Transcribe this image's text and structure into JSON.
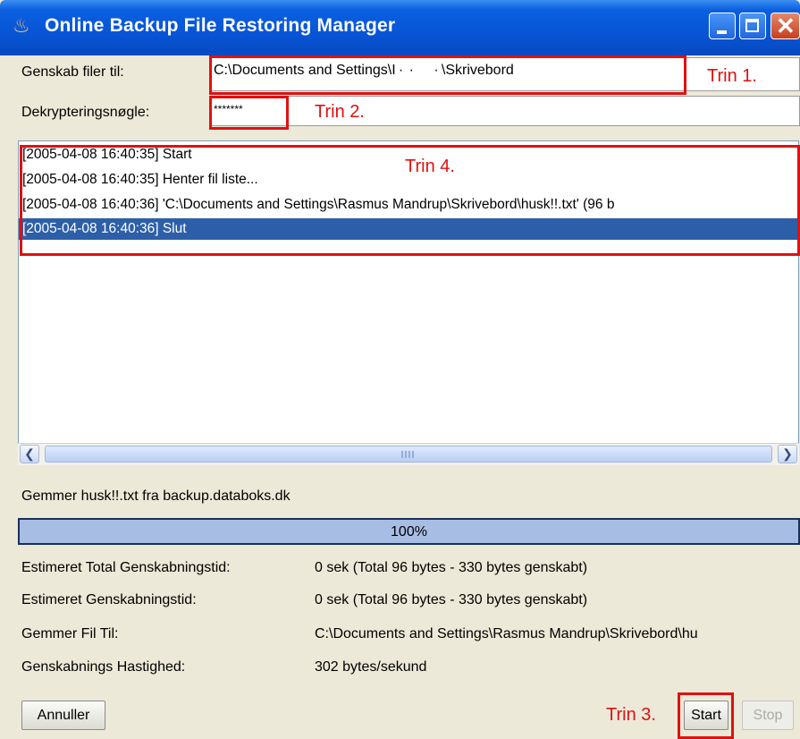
{
  "window": {
    "title": "Online Backup File Restoring Manager",
    "icon": "java-cup-icon"
  },
  "form": {
    "restore_to_label": "Genskab filer til:",
    "restore_to_value": "C:\\Documents and Settings\\I ·  ·       · \\Skrivebord",
    "key_label": "Dekrypteringsnøgle:",
    "key_value": "*******"
  },
  "annotations": {
    "trin1": "Trin 1.",
    "trin2": "Trin 2.",
    "trin3": "Trin 3.",
    "trin4": "Trin 4."
  },
  "log": {
    "lines": [
      "[2005-04-08 16:40:35] Start",
      "[2005-04-08 16:40:35] Henter fil liste...",
      "[2005-04-08 16:40:36] 'C:\\Documents and Settings\\Rasmus Mandrup\\Skrivebord\\husk!!.txt' (96 b",
      "[2005-04-08 16:40:36] Slut"
    ],
    "selected_index": 3
  },
  "status": {
    "message": "Gemmer husk!!.txt fra backup.databoks.dk",
    "progress_percent": 100,
    "progress_label": "100%"
  },
  "stats": [
    {
      "label": "Estimeret Total Genskabningstid:",
      "value": "0 sek (Total 96 bytes - 330 bytes genskabt)"
    },
    {
      "label": "Estimeret Genskabningstid:",
      "value": "0 sek (Total 96 bytes - 330 bytes genskabt)"
    },
    {
      "label": "Gemmer Fil Til:",
      "value": "C:\\Documents and Settings\\Rasmus Mandrup\\Skrivebord\\hu"
    },
    {
      "label": "Genskabnings Hastighed:",
      "value": "302 bytes/sekund"
    }
  ],
  "buttons": {
    "cancel": "Annuller",
    "start": "Start",
    "stop": "Stop"
  },
  "colors": {
    "annotation_red": "#e01010",
    "selection_blue": "#2d5fa8",
    "titlebar_blue": "#0755d6"
  }
}
